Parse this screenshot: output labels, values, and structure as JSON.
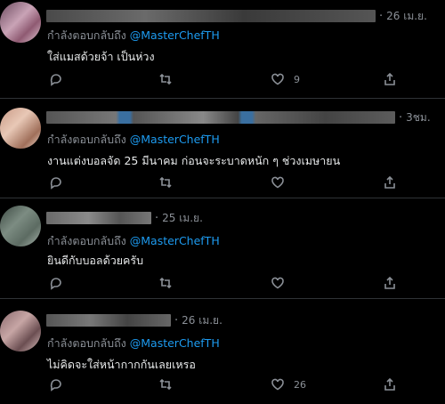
{
  "tweets": [
    {
      "date": "26 เม.ย.",
      "replying_prefix": "กำลังตอบกลับถึง",
      "replying_handle": "@MasterChefTH",
      "text": "ใส่แมสด้วยจ้า เป็นห่วง",
      "like_count": "9",
      "avatar_colors": [
        "#6b4a5e",
        "#c9a3b6",
        "#8f5a72",
        "#e2c9d4"
      ]
    },
    {
      "date": "3ชม.",
      "replying_prefix": "กำลังตอบกลับถึง",
      "replying_handle": "@MasterChefTH",
      "text": "งานแต่งบอลจัด 25 มีนาคม ก่อนจะระบาดหนัก ๆ ช่วงเมษายน",
      "like_count": "",
      "avatar_colors": [
        "#c99a86",
        "#e8c8b6",
        "#a06f5a",
        "#f1dccf"
      ]
    },
    {
      "date": "25 เม.ย.",
      "replying_prefix": "กำลังตอบกลับถึง",
      "replying_handle": "@MasterChefTH",
      "text": "ยินดีกับบอลด้วยครับ",
      "like_count": "",
      "avatar_colors": [
        "#3d4a43",
        "#7c8c82",
        "#5c6b62",
        "#a9b5ad"
      ]
    },
    {
      "date": "26 เม.ย.",
      "replying_prefix": "กำลังตอบกลับถึง",
      "replying_handle": "@MasterChefTH",
      "text": "ไม่คิดจะใส่หน้ากากกันเลยเหรอ",
      "like_count": "26",
      "avatar_colors": [
        "#8a6a6e",
        "#c7a6a5",
        "#6b4e52",
        "#dcc2be"
      ]
    }
  ],
  "icons": {
    "reply": "reply-icon",
    "retweet": "retweet-icon",
    "like": "heart-icon",
    "share": "share-icon"
  }
}
